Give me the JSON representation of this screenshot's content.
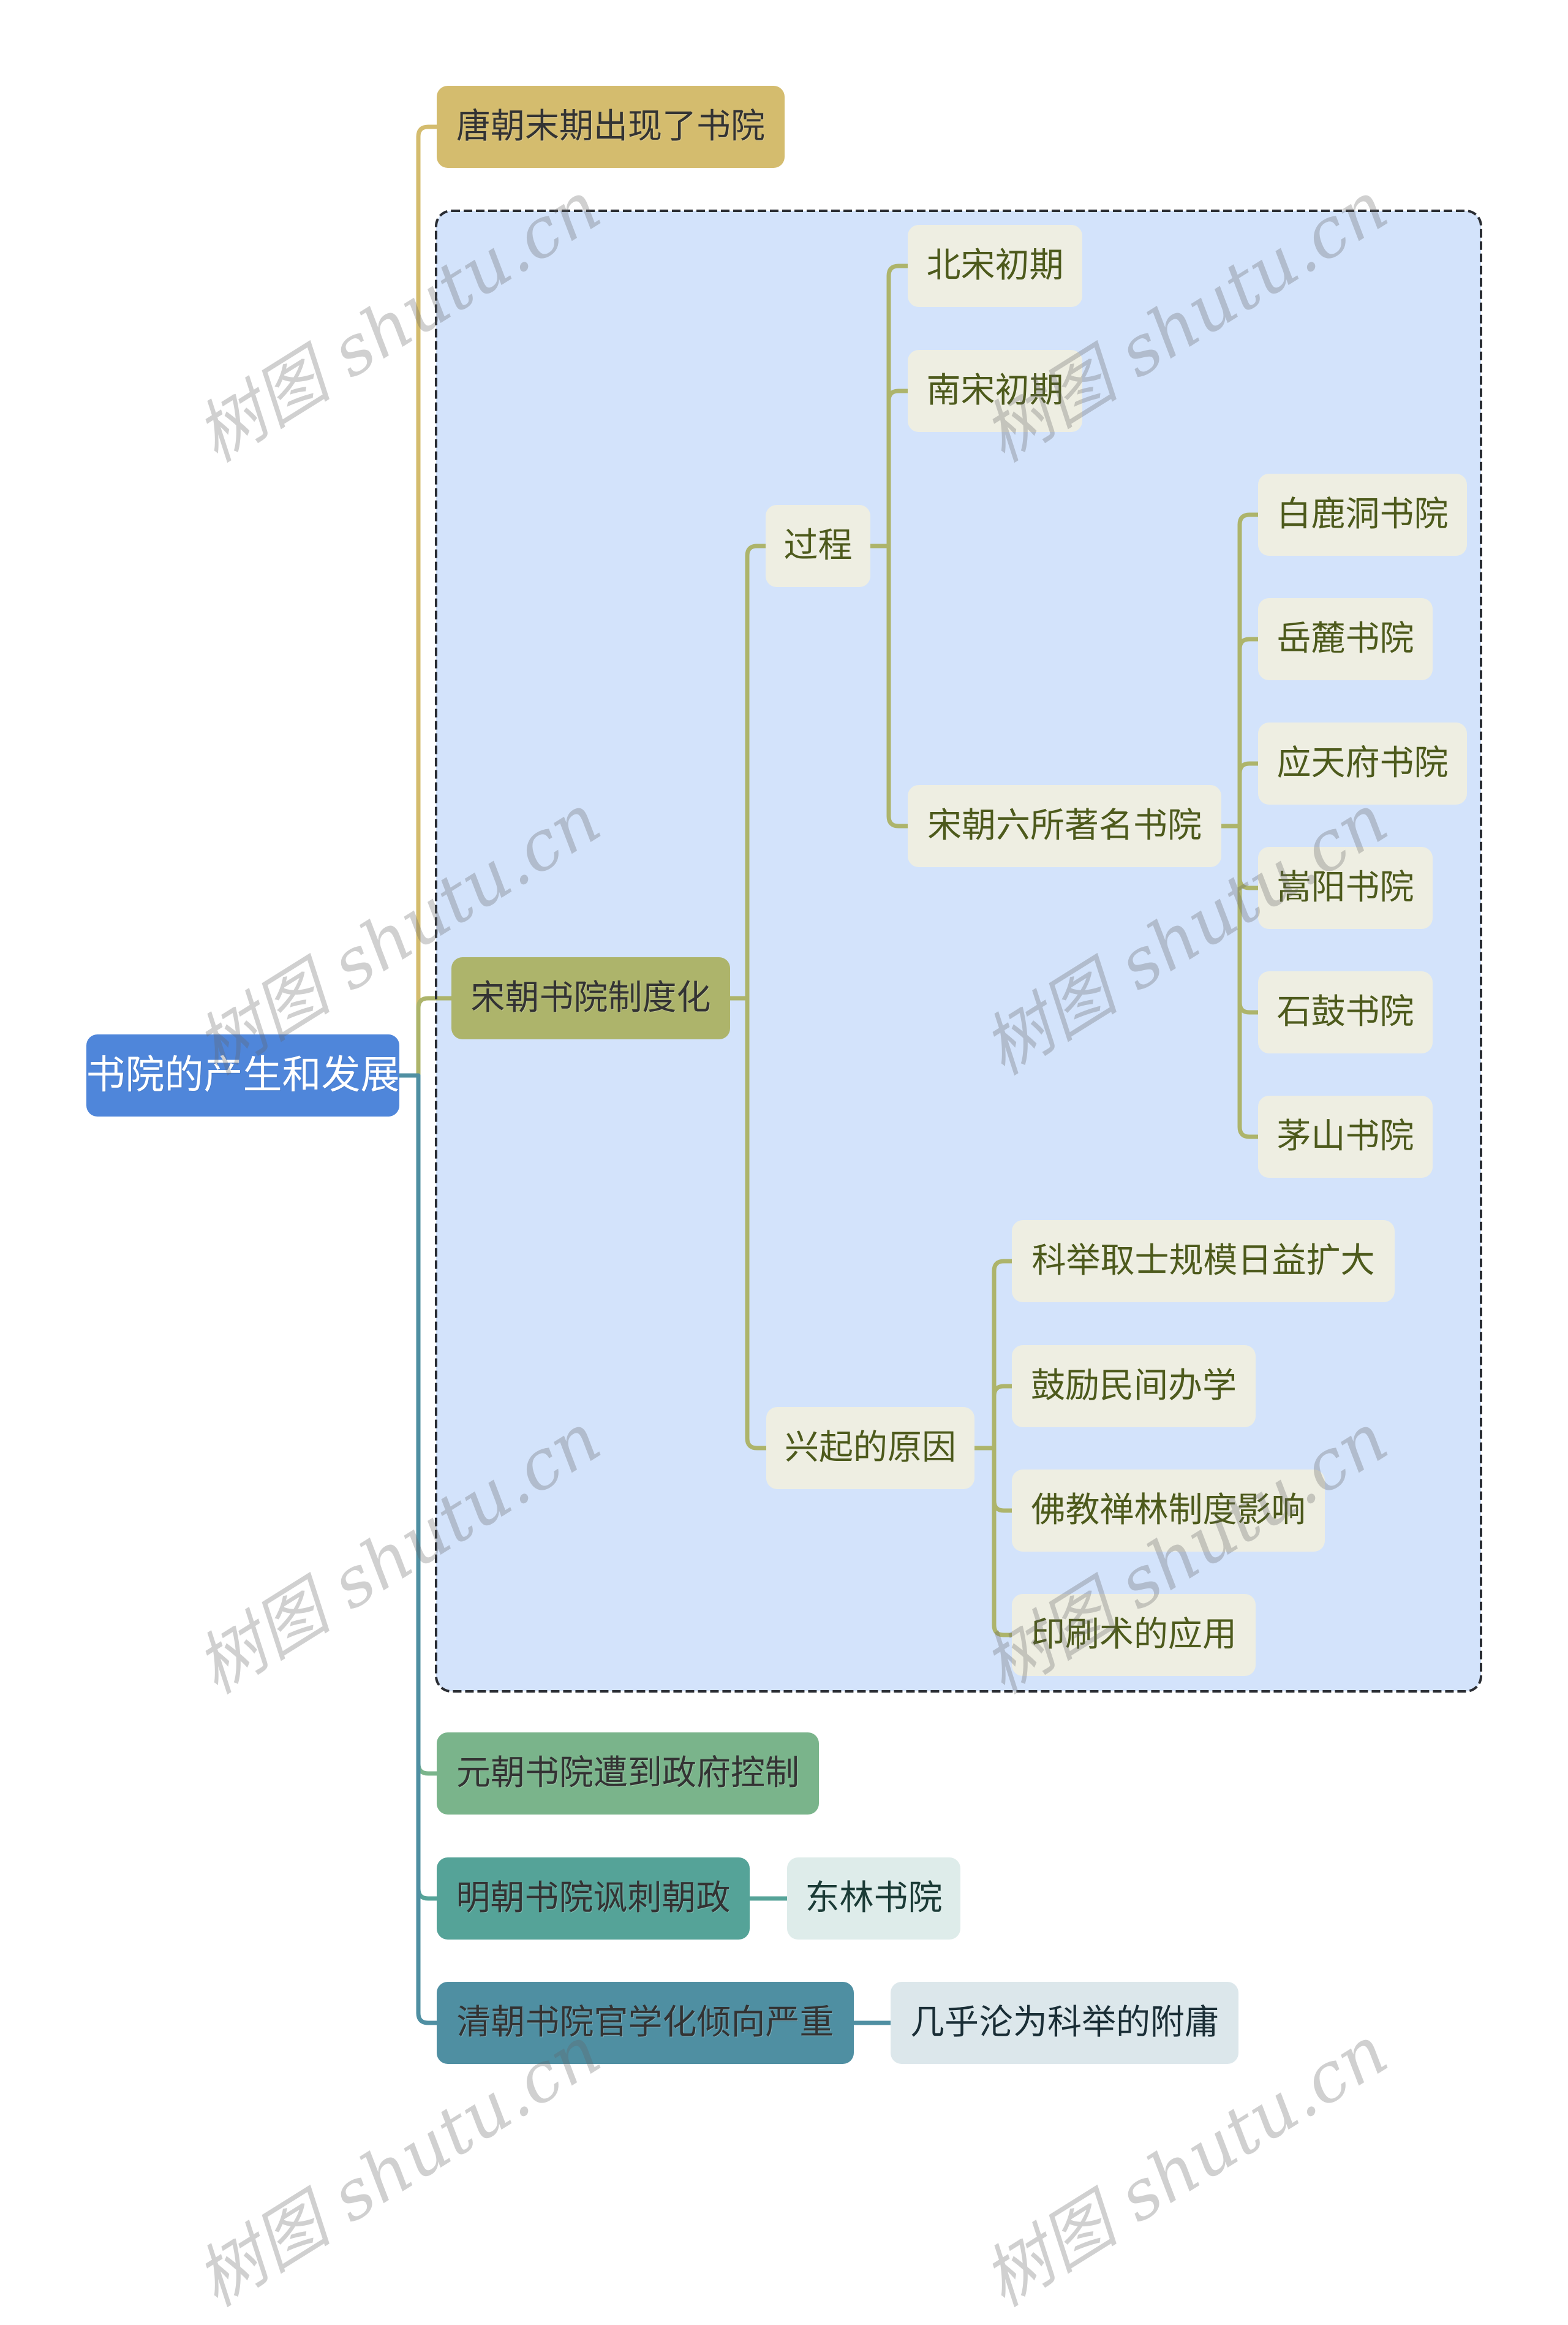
{
  "root": {
    "label": "书院的产生和发展",
    "color": "#4f86da"
  },
  "branches": [
    {
      "label": "唐朝末期出现了书院",
      "color": "#d4bc6e"
    },
    {
      "label": "宋朝书院制度化",
      "color": "#adb46b",
      "boundary_fill": "#d3e3fb",
      "boundary_stroke": "#2a2d33",
      "subtopic_color": "#eeeee2",
      "children": [
        {
          "label": "过程",
          "children": [
            {
              "label": "北宋初期"
            },
            {
              "label": "南宋初期"
            },
            {
              "label": "宋朝六所著名书院",
              "children": [
                {
                  "label": "白鹿洞书院"
                },
                {
                  "label": "岳麓书院"
                },
                {
                  "label": "应天府书院"
                },
                {
                  "label": "嵩阳书院"
                },
                {
                  "label": "石鼓书院"
                },
                {
                  "label": "茅山书院"
                }
              ]
            }
          ]
        },
        {
          "label": "兴起的原因",
          "children": [
            {
              "label": "科举取士规模日益扩大"
            },
            {
              "label": "鼓励民间办学"
            },
            {
              "label": "佛教禅林制度影响"
            },
            {
              "label": "印刷术的应用"
            }
          ]
        }
      ]
    },
    {
      "label": "元朝书院遭到政府控制",
      "color": "#7ab48b"
    },
    {
      "label": "明朝书院讽刺朝政",
      "color": "#55a398",
      "children": [
        {
          "label": "东林书院",
          "color": "#deecea"
        }
      ]
    },
    {
      "label": "清朝书院官学化倾向严重",
      "color": "#4f8fa2",
      "children": [
        {
          "label": "几乎沦为科举的附庸",
          "color": "#dce7eb"
        }
      ]
    }
  ],
  "watermark": "树图 shutu.cn"
}
